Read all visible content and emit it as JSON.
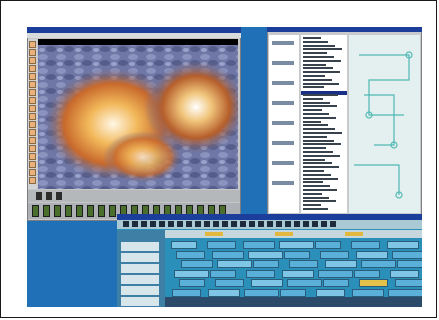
{
  "screenshot": {
    "description_colors": {
      "desktop": "#1f70b6",
      "window_chrome": "#c5c7c9",
      "title_bar": "#1b3e9a",
      "timeline_bg": "#2a8fb9",
      "accent_gold": "#e3b83f"
    },
    "editor": {
      "tool_buttons": 18,
      "filmstrip_thumbs": 18
    },
    "browser": {
      "tree_nodes": 8,
      "list_rows": 46
    },
    "timeline": {
      "tracks": 6
    }
  }
}
